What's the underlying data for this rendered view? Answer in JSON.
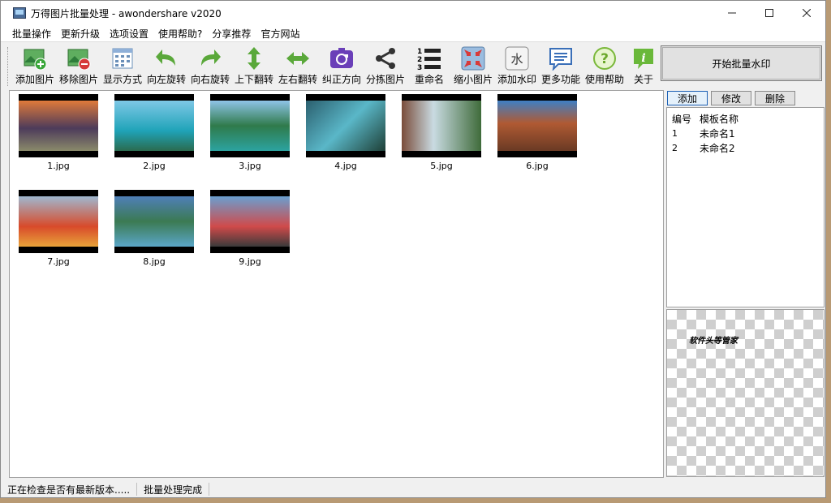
{
  "window": {
    "title": "万得图片批量处理 - awondershare v2020"
  },
  "menu": [
    "批量操作",
    "更新升级",
    "选项设置",
    "使用帮助?",
    "分享推荐",
    "官方网站"
  ],
  "toolbar": {
    "items": [
      {
        "label": "添加图片",
        "icon": "add-image-icon"
      },
      {
        "label": "移除图片",
        "icon": "remove-image-icon"
      },
      {
        "label": "显示方式",
        "icon": "grid-view-icon"
      },
      {
        "label": "向左旋转",
        "icon": "rotate-left-icon"
      },
      {
        "label": "向右旋转",
        "icon": "rotate-right-icon"
      },
      {
        "label": "上下翻转",
        "icon": "flip-vertical-icon"
      },
      {
        "label": "左右翻转",
        "icon": "flip-horizontal-icon"
      },
      {
        "label": "纠正方向",
        "icon": "auto-orient-icon"
      },
      {
        "label": "分拣图片",
        "icon": "share-sort-icon"
      },
      {
        "label": "重命名",
        "icon": "numbered-list-icon"
      },
      {
        "label": "缩小图片",
        "icon": "shrink-icon"
      },
      {
        "label": "添加水印",
        "icon": "watermark-icon"
      },
      {
        "label": "更多功能",
        "icon": "more-features-icon"
      },
      {
        "label": "使用帮助",
        "icon": "help-icon"
      },
      {
        "label": "关于",
        "icon": "info-icon"
      }
    ],
    "start_button": "开始批量水印"
  },
  "images": [
    {
      "name": "1.jpg",
      "colors": [
        "#e07a3a",
        "#4d3b5a",
        "#8a8a6a"
      ]
    },
    {
      "name": "2.jpg",
      "colors": [
        "#7ec8e6",
        "#1fa3b8",
        "#2a6b4f"
      ]
    },
    {
      "name": "3.jpg",
      "colors": [
        "#8fc4e8",
        "#2f7a4b",
        "#2ca3a0"
      ]
    },
    {
      "name": "4.jpg",
      "colors": [
        "#2b5f6e",
        "#5ab7c8",
        "#1e3f36"
      ]
    },
    {
      "name": "5.jpg",
      "colors": [
        "#c9dbe2",
        "#7a4c3a",
        "#3f6b3a"
      ]
    },
    {
      "name": "6.jpg",
      "colors": [
        "#3f7fc4",
        "#b05a33",
        "#6a3a24"
      ]
    },
    {
      "name": "7.jpg",
      "colors": [
        "#9fb8d0",
        "#d84a2a",
        "#e8a33a"
      ]
    },
    {
      "name": "8.jpg",
      "colors": [
        "#4f7fb8",
        "#3b7a52",
        "#5aa6c8"
      ]
    },
    {
      "name": "9.jpg",
      "colors": [
        "#6a9fd0",
        "#d04a4a",
        "#3a3a3a"
      ]
    }
  ],
  "side": {
    "buttons": [
      "添加",
      "修改",
      "删除"
    ],
    "columns": [
      "编号",
      "模板名称"
    ],
    "rows": [
      {
        "id": "1",
        "name": "未命名1"
      },
      {
        "id": "2",
        "name": "未命名2"
      }
    ],
    "watermark_preview": "软件头等管家"
  },
  "status": [
    "正在检查是否有最新版本.....",
    "批量处理完成"
  ]
}
